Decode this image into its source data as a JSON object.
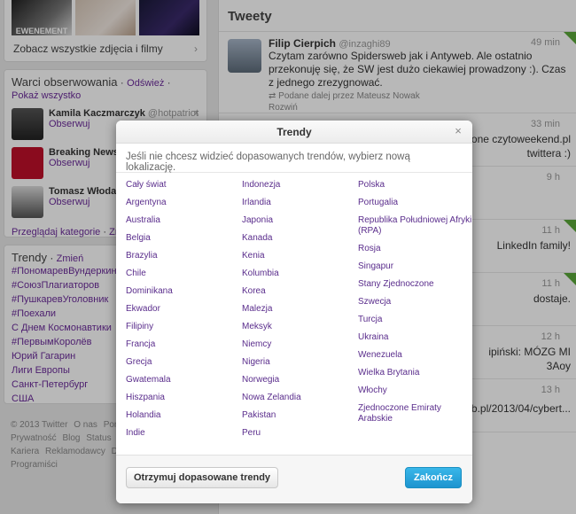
{
  "left": {
    "media": {
      "banner_text": "EWENEMENT",
      "link": "Zobacz wszystkie zdjęcia i filmy",
      "chevron": "›"
    },
    "who_to_follow": {
      "title": "Warci obserwowania",
      "sep": "·",
      "refresh": "Odśwież",
      "show_all": "Pokaż wszystko",
      "items": [
        {
          "name": "Kamila Kaczmarczyk",
          "handle": "@hotpatriot",
          "follow": "Obserwuj",
          "close": "×"
        },
        {
          "name": "Breaking News",
          "handle": "",
          "follow": "Obserwuj"
        },
        {
          "name": "Tomasz Włodarczyk",
          "handle": "",
          "follow": "Obserwuj"
        }
      ],
      "browse": "Przeglądaj kategorie",
      "find": "Znajdź"
    },
    "trends": {
      "title": "Trendy",
      "sep": "·",
      "change": "Zmień",
      "items": [
        "#ПономаревВундеркинд",
        "#СоюзПлагиаторов",
        "#ПушкаревУголовник",
        "#Поехали",
        "С Днем Космонавтики",
        "#ПервымКоролёв",
        "Юрий Гагарин",
        "Лиги Европы",
        "Санкт-Петербург",
        "США"
      ]
    },
    "footer": {
      "line1": [
        "© 2013 Twitter",
        "O nas",
        "Pom"
      ],
      "line2": [
        "Prywatność",
        "Blog",
        "Status",
        "A"
      ],
      "line3": [
        "Kariera",
        "Reklamodawcy",
        "D"
      ],
      "line4": [
        "Programiści"
      ]
    }
  },
  "timeline": {
    "title": "Tweety",
    "tweets": [
      {
        "name": "Filip Cierpich",
        "handle": "@inzaghi89",
        "time": "49 min",
        "text": "Czytam zarówno Spidersweb jak i Antyweb. Ale ostatnio przekonuję się, że SW jest dużo ciekawiej prowadzony :). Czas z jednego zrezygnować.",
        "retweet": "Podane dalej przez Mateusz Nowak",
        "expand": "Rozwiń"
      }
    ],
    "fragments": {
      "t2_time": "33 min",
      "t2_a": "one czytoweekend.pl",
      "t2_b": "twittera :)",
      "t3_time": "9 h",
      "t4_time": "11 h",
      "t4_a": "LinkedIn family!",
      "t5_time": "11 h",
      "t5_a": "dostaje.",
      "t6_time": "12 h",
      "t6_a": "ipiński: MÓZG MI",
      "t6_b": "3Aoy",
      "t7_time": "13 h",
      "t7_a": "spidersweb.pl/2013/04/cybert..."
    }
  },
  "modal": {
    "title": "Trendy",
    "close": "×",
    "description": "Jeśli nie chcesz widzieć dopasowanych trendów, wybierz nową lokalizację.",
    "columns": [
      [
        "Cały świat",
        "Argentyna",
        "Australia",
        "Belgia",
        "Brazylia",
        "Chile",
        "Dominikana",
        "Ekwador",
        "Filipiny",
        "Francja",
        "Grecja",
        "Gwatemala",
        "Hiszpania",
        "Holandia",
        "Indie"
      ],
      [
        "Indonezja",
        "Irlandia",
        "Japonia",
        "Kanada",
        "Kenia",
        "Kolumbia",
        "Korea",
        "Malezja",
        "Meksyk",
        "Niemcy",
        "Nigeria",
        "Norwegia",
        "Nowa Zelandia",
        "Pakistan",
        "Peru"
      ],
      [
        "Polska",
        "Portugalia",
        "Republika Południowej Afryki (RPA)",
        "Rosja",
        "Singapur",
        "Stany Zjednoczone",
        "Szwecja",
        "Turcja",
        "Ukraina",
        "Wenezuela",
        "Wielka Brytania",
        "Włochy",
        "Zjednoczone Emiraty Arabskie"
      ]
    ],
    "personalized_button": "Otrzymuj dopasowane trendy",
    "done_button": "Zakończ"
  }
}
